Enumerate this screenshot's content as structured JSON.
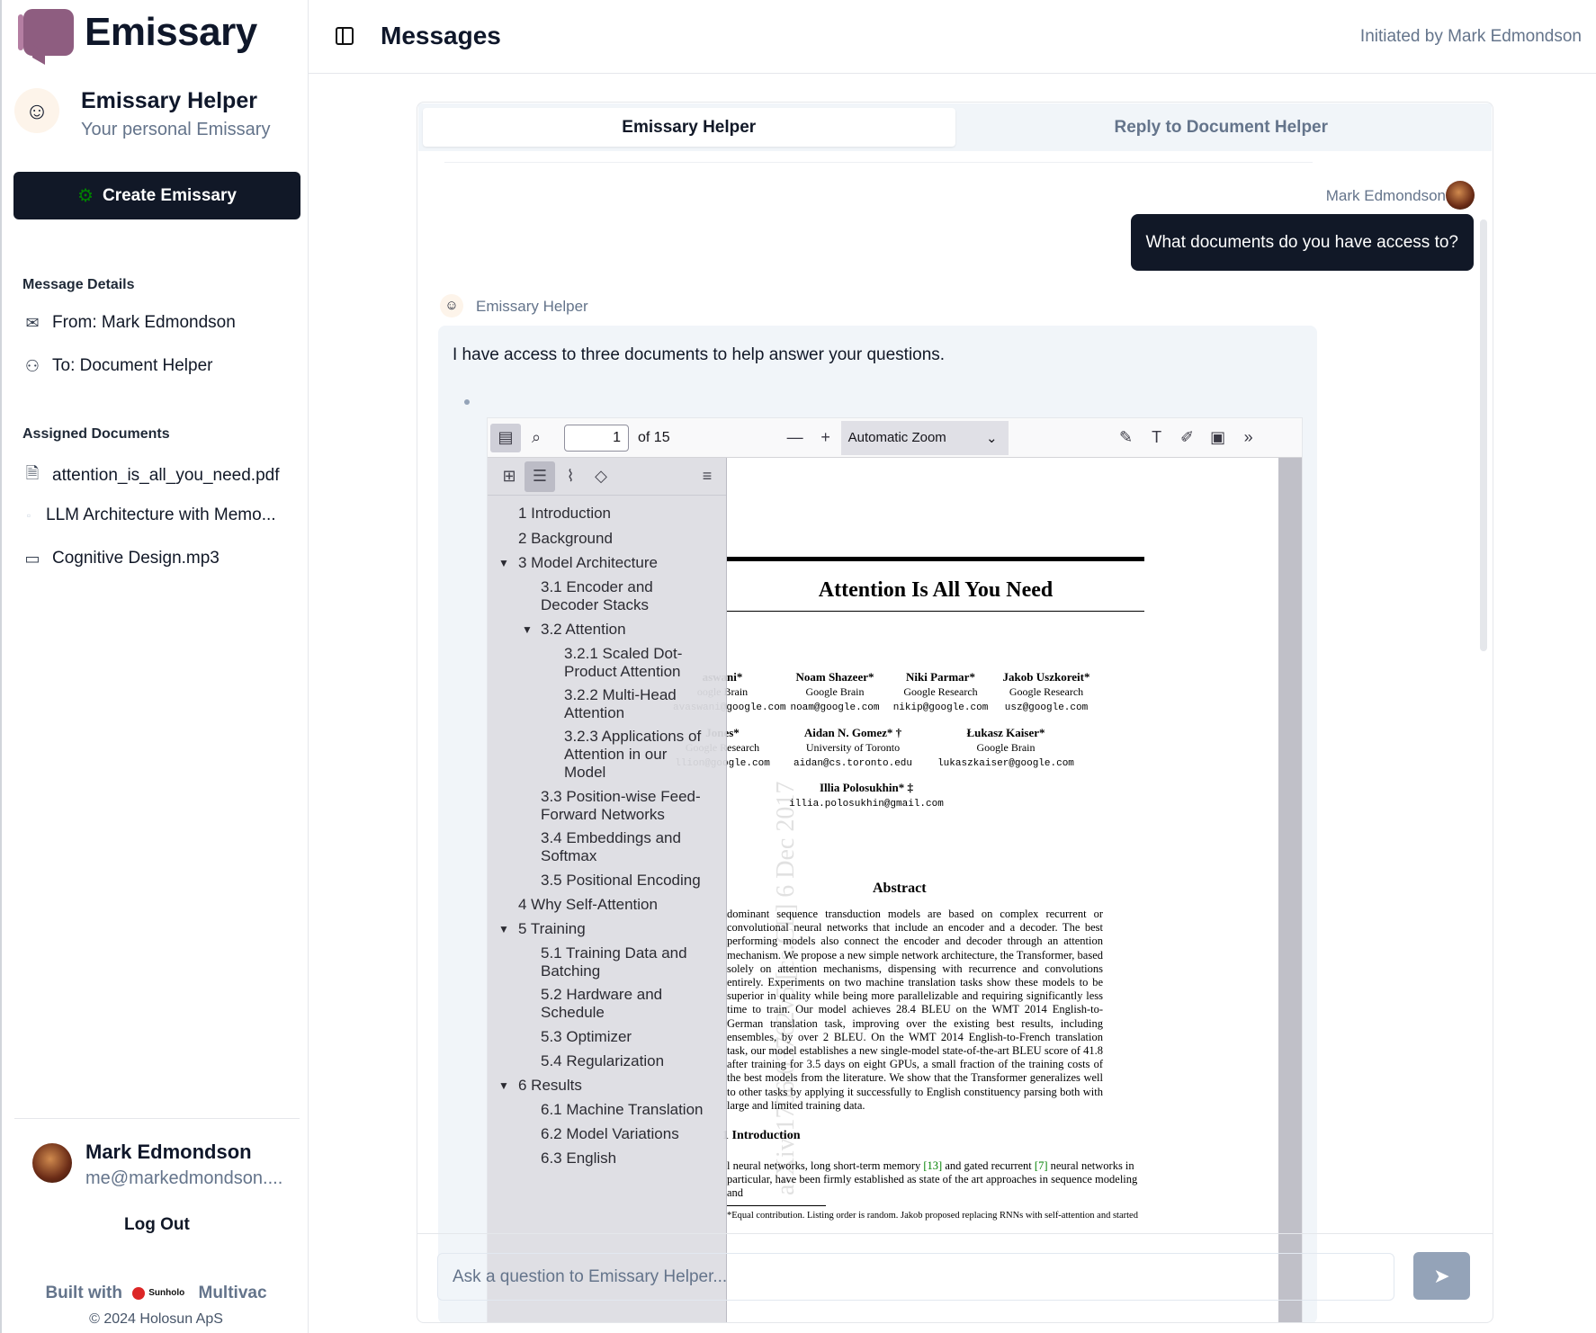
{
  "app": {
    "name": "Emissary",
    "page_title": "Messages",
    "initiated": "Initiated by Mark Edmondson"
  },
  "helper": {
    "name": "Emissary Helper",
    "subtitle": "Your personal Emissary"
  },
  "create_button": "Create Emissary",
  "details": {
    "heading": "Message Details",
    "from": "From: Mark Edmondson",
    "to": "To: Document Helper"
  },
  "documents": {
    "heading": "Assigned Documents",
    "items": [
      "attention_is_all_you_need.pdf",
      "LLM Architecture with Memo...",
      "Cognitive Design.mp3"
    ]
  },
  "user": {
    "name": "Mark Edmondson",
    "email": "me@markedmondson....",
    "logout": "Log Out"
  },
  "footer": {
    "built": "Built with",
    "brand": "Sunholo",
    "product": "Multivac",
    "copyright": "© 2024 Holosun ApS"
  },
  "tabs": [
    "Emissary Helper",
    "Reply to Document Helper"
  ],
  "chat": {
    "user_sender": "Mark Edmondson",
    "user_message": "What documents do you have access to?",
    "bot_sender": "Emissary Helper",
    "bot_message": "I have access to three documents to help answer your questions."
  },
  "pdf": {
    "page": "1",
    "of": "of 15",
    "zoom": "Automatic Zoom",
    "outline": [
      "1 Introduction",
      "2 Background",
      "3 Model Architecture",
      "3.1 Encoder and",
      "Decoder Stacks",
      "3.2 Attention",
      "3.2.1 Scaled Dot-",
      "Product Attention",
      "3.2.2 Multi-Head",
      "Attention",
      "3.2.3 Applications of",
      "Attention in our",
      "Model",
      "3.3 Position-wise Feed-",
      "Forward Networks",
      "3.4 Embeddings and",
      "Softmax",
      "3.5 Positional Encoding",
      "4 Why Self-Attention",
      "5 Training",
      "5.1 Training Data and",
      "Batching",
      "5.2 Hardware and",
      "Schedule",
      "5.3 Optimizer",
      "5.4 Regularization",
      "6 Results",
      "6.1 Machine Translation",
      "6.2 Model Variations",
      "6.3 English"
    ],
    "title": "Attention Is All You Need",
    "authors": [
      {
        "name": "aswani*",
        "org": "oogle Brain",
        "mail": "avaswani@google.com"
      },
      {
        "name": "Noam Shazeer*",
        "org": "Google Brain",
        "mail": "noam@google.com"
      },
      {
        "name": "Niki Parmar*",
        "org": "Google Research",
        "mail": "nikip@google.com"
      },
      {
        "name": "Jakob Uszkoreit*",
        "org": "Google Research",
        "mail": "usz@google.com"
      },
      {
        "name": "Jones*",
        "org": "Google Research",
        "mail": "llion@google.com"
      },
      {
        "name": "Aidan N. Gomez* †",
        "org": "University of Toronto",
        "mail": "aidan@cs.toronto.edu"
      },
      {
        "name": "Łukasz Kaiser*",
        "org": "Google Brain",
        "mail": "lukaszkaiser@google.com"
      },
      {
        "name": "Illia Polosukhin* ‡",
        "org": "",
        "mail": "illia.polosukhin@gmail.com"
      }
    ],
    "abstract_heading": "Abstract",
    "abstract": "dominant sequence transduction models are based on complex recurrent or convolutional neural networks that include an encoder and a decoder. The best performing models also connect the encoder and decoder through an attention mechanism. We propose a new simple network architecture, the Transformer, based solely on attention mechanisms, dispensing with recurrence and convolutions entirely. Experiments on two machine translation tasks show these models to be superior in quality while being more parallelizable and requiring significantly less time to train. Our model achieves 28.4 BLEU on the WMT 2014 English-to-German translation task, improving over the existing best results, including ensembles, by over 2 BLEU. On the WMT 2014 English-to-French translation task, our model establishes a new single-model state-of-the-art BLEU score of 41.8 after training for 3.5 days on eight GPUs, a small fraction of the training costs of the best models from the literature. We show that the Transformer generalizes well to other tasks by applying it successfully to English constituency parsing both with large and limited training data.",
    "intro_heading": "1 Introduction",
    "intro_a": "l neural networks, long short-term memory ",
    "intro_ref1": "[13]",
    "intro_b": " and gated recurrent ",
    "intro_ref2": "[7]",
    "intro_c": " neural networks in particular, have been firmly established as state of the art approaches in sequence modeling and",
    "footnote": "*Equal contribution. Listing order is random. Jakob proposed replacing RNNs with self-attention and started",
    "watermark": "arXiv:1706.03762v5 [cs.CL] 6 Dec 2017"
  },
  "input": {
    "placeholder": "Ask a question to Emissary Helper..."
  },
  "icons": {
    "send": "send-icon",
    "settings": "gear-icon",
    "mail": "mail-icon",
    "person": "person-icon",
    "file": "file-icon",
    "video": "video-icon"
  }
}
